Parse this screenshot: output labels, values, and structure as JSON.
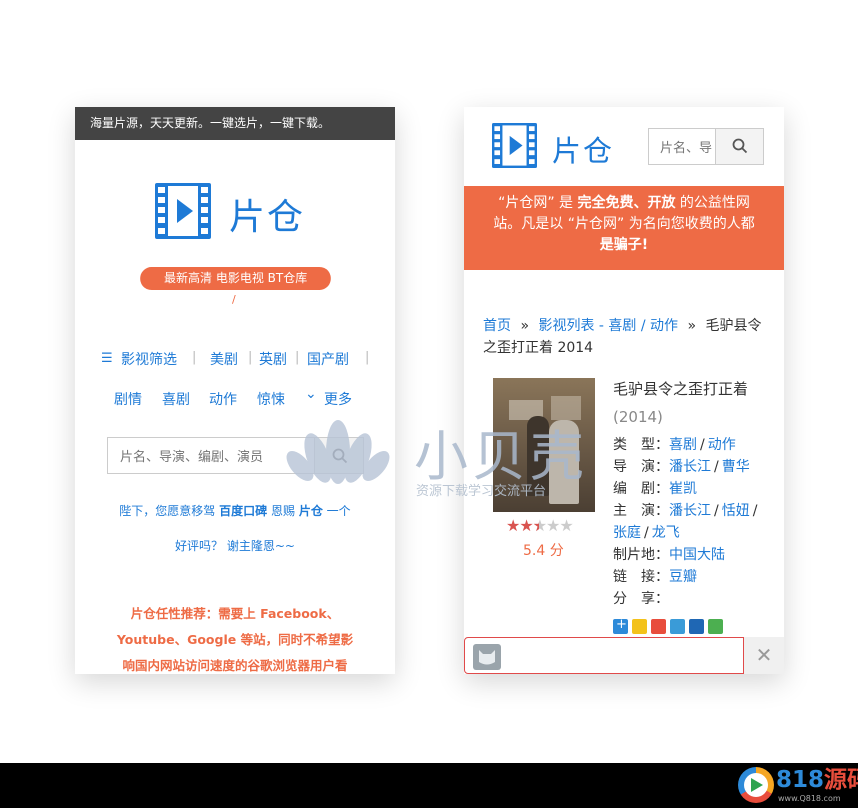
{
  "left_phone": {
    "top_notice": "海量片源，天天更新。一键选片，一键下载。",
    "logo_text": "片仓",
    "tagline": "最新高清 电影电视 BT仓库",
    "tagline_mark": "/",
    "nav_row1": [
      {
        "label": "影视筛选",
        "icon": "list-icon"
      },
      {
        "label": "美剧"
      },
      {
        "label": "英剧"
      },
      {
        "label": "国产剧"
      }
    ],
    "nav_row2": [
      {
        "label": "剧情"
      },
      {
        "label": "喜剧"
      },
      {
        "label": "动作"
      },
      {
        "label": "惊悚"
      },
      {
        "label": "更多",
        "icon": "chevron-down-icon"
      }
    ],
    "search_placeholder": "片名、导演、编剧、演员",
    "request_line1_a": "陛下，您愿意移驾",
    "request_line1_b": "百度口碑",
    "request_line1_c": "恩赐",
    "request_line1_d": "片仓",
    "request_line1_e": "一个",
    "request_line2": "好评吗？ 谢主隆恩~~",
    "notice_lines": [
      "片仓任性推荐：需要上 Facebook、",
      "Youtube、Google 等站，同时不希望影",
      "响国内网站访问速度的谷歌浏览器用户看"
    ]
  },
  "right_phone": {
    "logo_text": "片仓",
    "search_placeholder": "片名、导",
    "banner_line1_a": "“片仓网” 是 ",
    "banner_line1_b": "完全免费、开放",
    "banner_line1_c": " 的公益性网",
    "banner_line2": "站。凡是以 “片仓网” 为名向您收费的人都",
    "banner_line3": "是骗子!",
    "breadcrumb": {
      "home": "首页",
      "sep": "»",
      "list": "影视列表 - 喜剧 / 动作",
      "current_line1": "毛驴县令",
      "current_line2": "之歪打正着 2014"
    },
    "movie": {
      "title": "毛驴县令之歪打正着",
      "year": "(2014)",
      "rating": "5.4 分",
      "rating_stars": 2.5,
      "fields": [
        {
          "key": "类　型：",
          "values": [
            "喜剧",
            "/",
            "动作"
          ]
        },
        {
          "key": "导　演：",
          "values": [
            "潘长江",
            "/",
            "曹华"
          ]
        },
        {
          "key": "编　剧：",
          "values": [
            "崔凯"
          ]
        },
        {
          "key": "主　演：",
          "values": [
            "潘长江",
            "/",
            "恬妞",
            "/"
          ]
        },
        {
          "key": "",
          "values": [
            "张庭",
            "/",
            "龙飞"
          ]
        },
        {
          "key": "制片地：",
          "values": [
            "中国大陆"
          ]
        },
        {
          "key": "链　接：",
          "values": [
            "豆瓣"
          ]
        },
        {
          "key": "分　享：",
          "values": []
        }
      ],
      "share_icons": [
        "plus-share-icon",
        "qzone-icon",
        "weibo-icon",
        "tencent-weibo-icon",
        "renren-icon",
        "wechat-icon"
      ]
    },
    "close_glyph": "✕"
  },
  "watermark": {
    "title": "小贝壳",
    "subtitle": "资源下载学习交流平台"
  },
  "footer_brand": {
    "number": "818",
    "text": "源码",
    "url": "www.Q818.com"
  },
  "colors": {
    "accent_blue": "#1e7ad6",
    "accent_orange": "#ee6b45",
    "topbar": "#444444"
  }
}
